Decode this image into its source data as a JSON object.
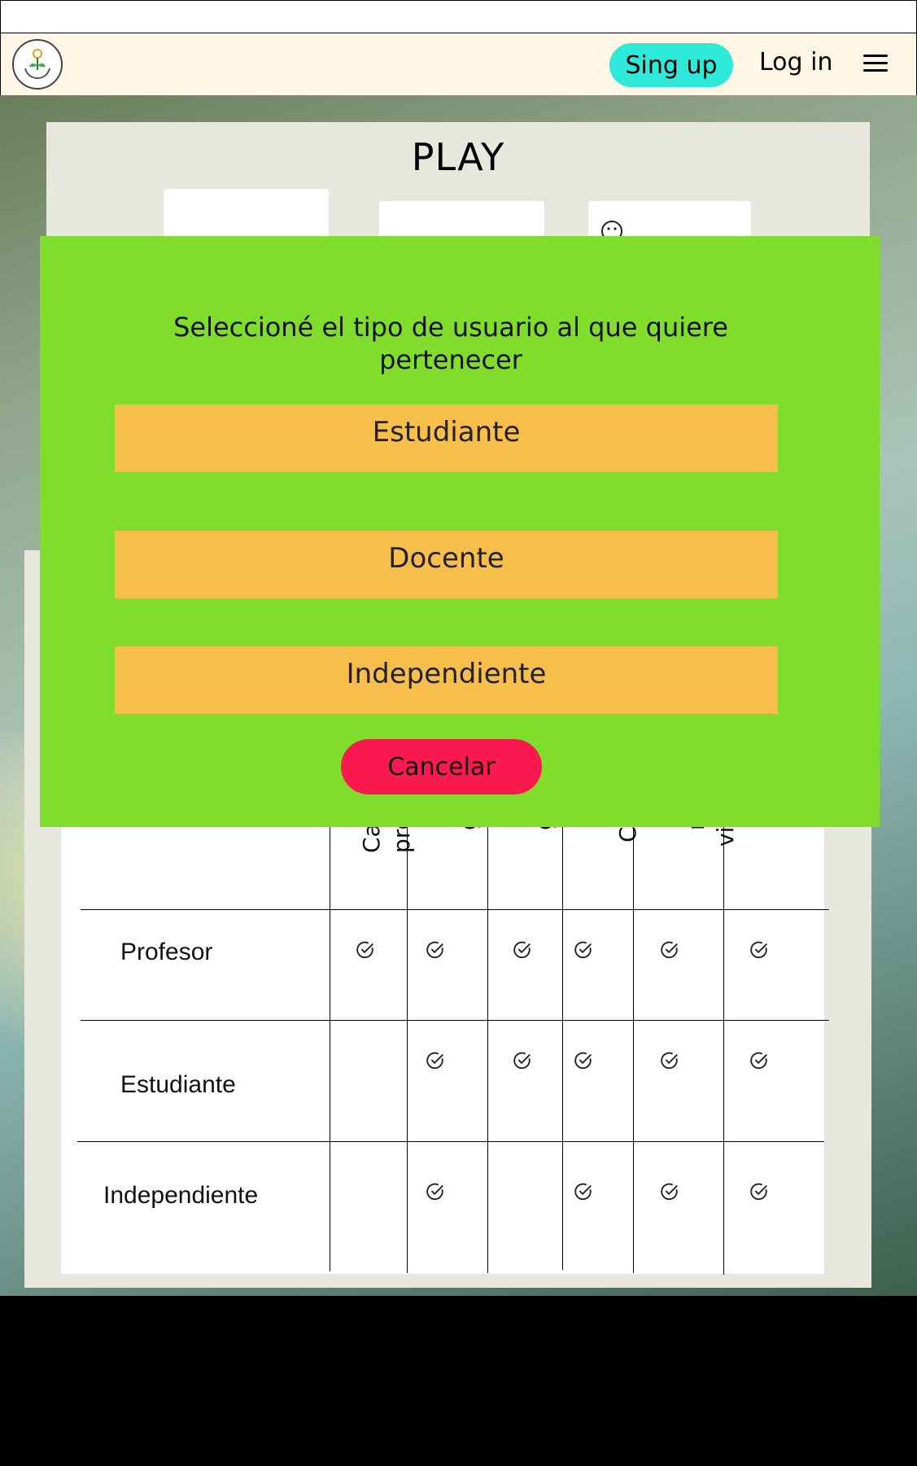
{
  "header": {
    "signup_label": "Sing up",
    "login_label": "Log in"
  },
  "page": {
    "title": "PLAY"
  },
  "modal": {
    "title": "Seleccioné el tipo de usuario al que quiere pertenecer",
    "options": [
      "Estudiante",
      "Docente",
      "Independiente"
    ],
    "cancel_label": "Cancelar"
  },
  "table": {
    "column_headers_partial": [
      "Ca",
      "pro",
      "g",
      "g",
      "C",
      "r",
      "vi"
    ],
    "rows": [
      {
        "label": "Profesor",
        "checks": [
          true,
          true,
          true,
          true,
          true,
          true
        ]
      },
      {
        "label": "Estudiante",
        "checks": [
          false,
          true,
          true,
          true,
          true,
          true
        ]
      },
      {
        "label": "Independiente",
        "checks": [
          false,
          true,
          false,
          true,
          true,
          true
        ]
      }
    ]
  },
  "colors": {
    "modal_bg": "#80dd2c",
    "option_bg": "#f7be4b",
    "cancel_bg": "#f81a4f",
    "signup_bg": "#2ee9d8",
    "navbar_bg": "#fff6e5"
  }
}
